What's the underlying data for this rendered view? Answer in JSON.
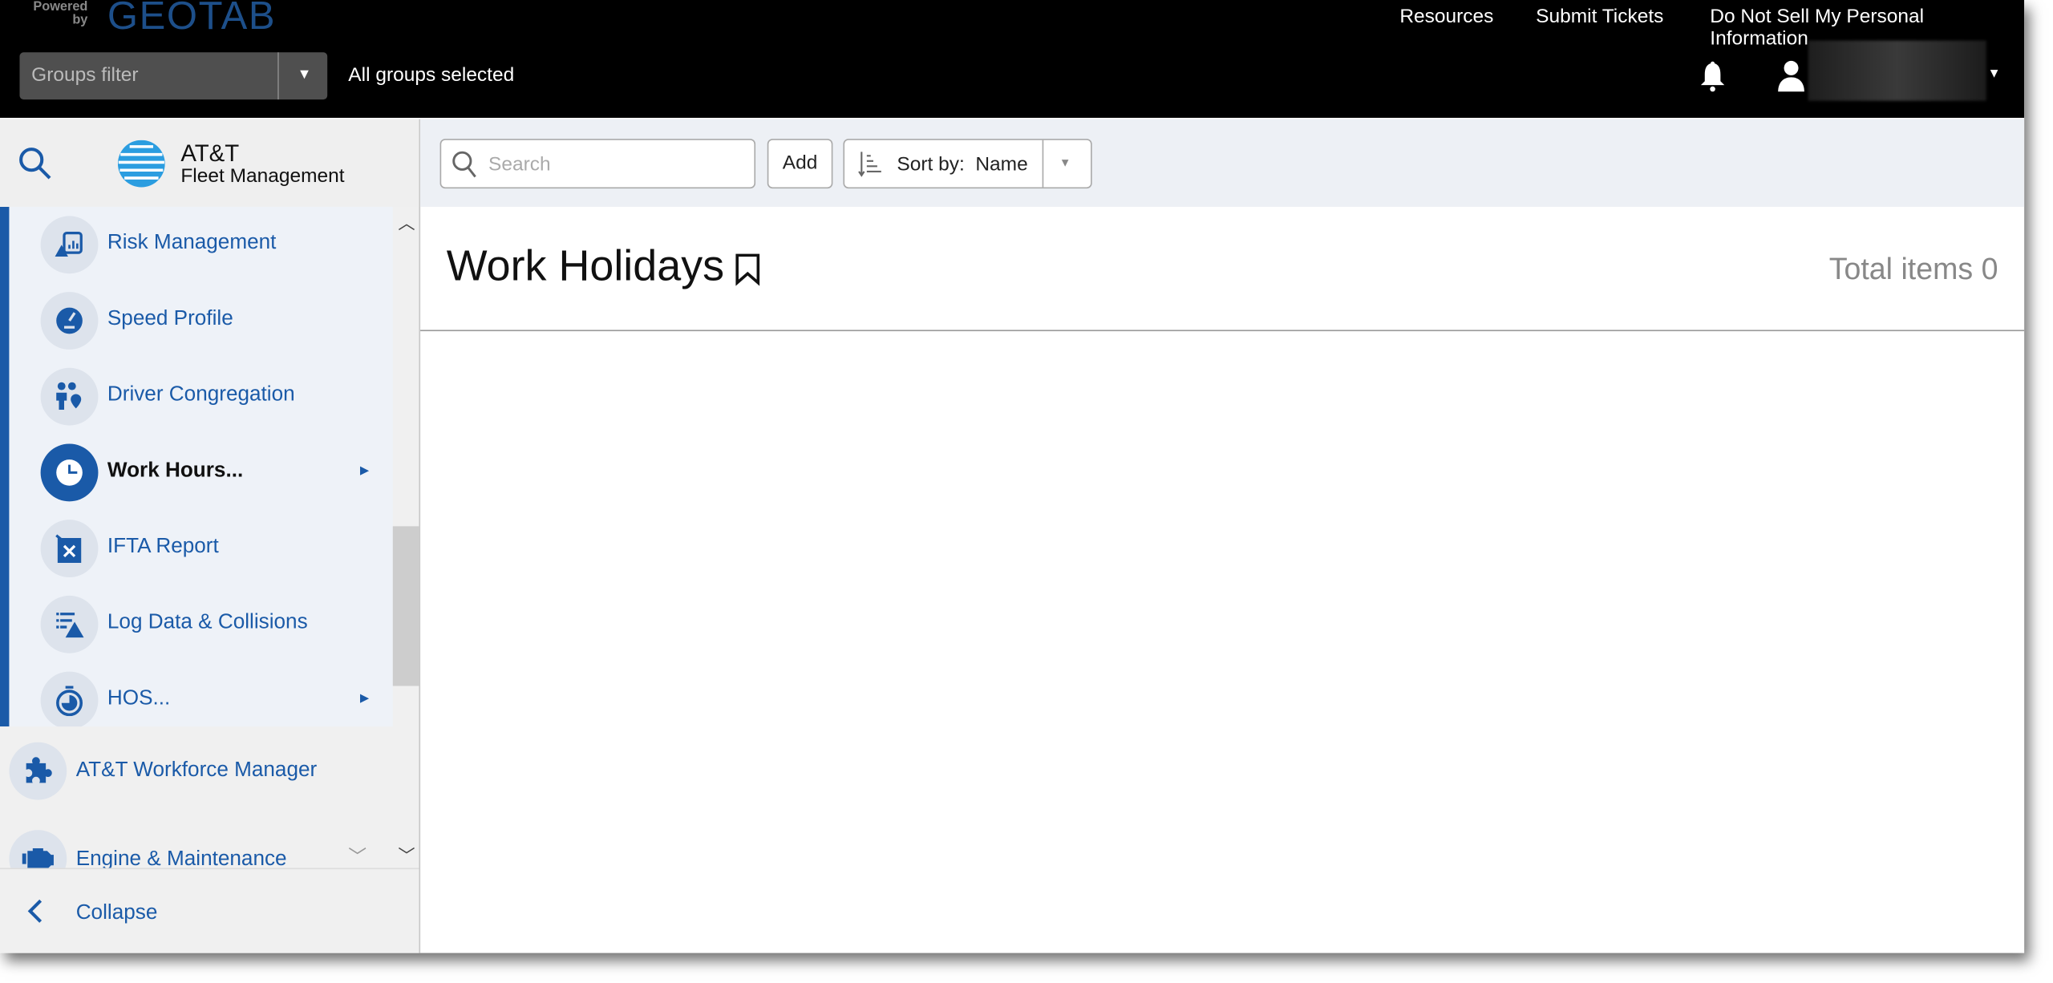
{
  "header": {
    "logo_powered": "Powered by",
    "logo_brand": "GEOTAB",
    "links": [
      "Resources",
      "Submit Tickets",
      "Do Not Sell My Personal Information"
    ],
    "groups_filter_placeholder": "Groups filter",
    "groups_status": "All groups selected"
  },
  "sidebar": {
    "brand_line1": "AT&T",
    "brand_line2": "Fleet Management",
    "sub_items": [
      {
        "label": "Risk Management",
        "icon": "risk-icon"
      },
      {
        "label": "Speed Profile",
        "icon": "speedometer-icon"
      },
      {
        "label": "Driver Congregation",
        "icon": "people-location-icon"
      },
      {
        "label": "Work Hours...",
        "icon": "clock-icon",
        "active": true,
        "has_submenu": true
      },
      {
        "label": "IFTA Report",
        "icon": "fuel-can-icon"
      },
      {
        "label": "Log Data & Collisions",
        "icon": "log-warning-icon"
      },
      {
        "label": "HOS...",
        "icon": "stopwatch-icon",
        "has_submenu": true
      }
    ],
    "workforce": "AT&T Workforce Manager",
    "engine": "Engine & Maintenance",
    "collapse": "Collapse"
  },
  "toolbar": {
    "search_placeholder": "Search",
    "add": "Add",
    "sort_label": "Sort by:",
    "sort_value": "Name"
  },
  "main": {
    "title": "Work Holidays",
    "total": "Total items 0"
  },
  "colors": {
    "accent": "#1a5aa8",
    "topbar": "#000000"
  }
}
